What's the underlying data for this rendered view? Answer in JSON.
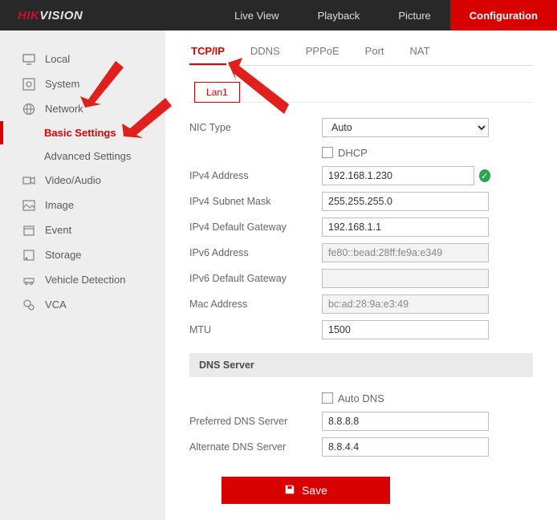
{
  "header": {
    "logo": {
      "hik": "HIK",
      "vision": "VISION"
    },
    "nav": {
      "live": "Live View",
      "playback": "Playback",
      "picture": "Picture",
      "config": "Configuration"
    }
  },
  "sidebar": {
    "local": "Local",
    "system": "System",
    "network": "Network",
    "basic": "Basic Settings",
    "advanced": "Advanced Settings",
    "videoaudio": "Video/Audio",
    "image": "Image",
    "event": "Event",
    "storage": "Storage",
    "vehicle": "Vehicle Detection",
    "vca": "VCA"
  },
  "tabs": {
    "tcpip": "TCP/IP",
    "ddns": "DDNS",
    "pppoe": "PPPoE",
    "port": "Port",
    "nat": "NAT"
  },
  "subtab": {
    "lan1": "Lan1"
  },
  "form": {
    "nic_label": "NIC Type",
    "nic_value": "Auto",
    "dhcp_label": "DHCP",
    "ipv4addr_label": "IPv4 Address",
    "ipv4addr_value": "192.168.1.230",
    "ipv4mask_label": "IPv4 Subnet Mask",
    "ipv4mask_value": "255.255.255.0",
    "ipv4gw_label": "IPv4 Default Gateway",
    "ipv4gw_value": "192.168.1.1",
    "ipv6addr_label": "IPv6 Address",
    "ipv6addr_value": "fe80::bead:28ff:fe9a:e349",
    "ipv6gw_label": "IPv6 Default Gateway",
    "ipv6gw_value": "",
    "mac_label": "Mac Address",
    "mac_value": "bc:ad:28:9a:e3:49",
    "mtu_label": "MTU",
    "mtu_value": "1500",
    "dns_section": "DNS Server",
    "autodns_label": "Auto DNS",
    "prefdns_label": "Preferred DNS Server",
    "prefdns_value": "8.8.8.8",
    "altdns_label": "Alternate DNS Server",
    "altdns_value": "8.8.4.4",
    "save": "Save"
  }
}
